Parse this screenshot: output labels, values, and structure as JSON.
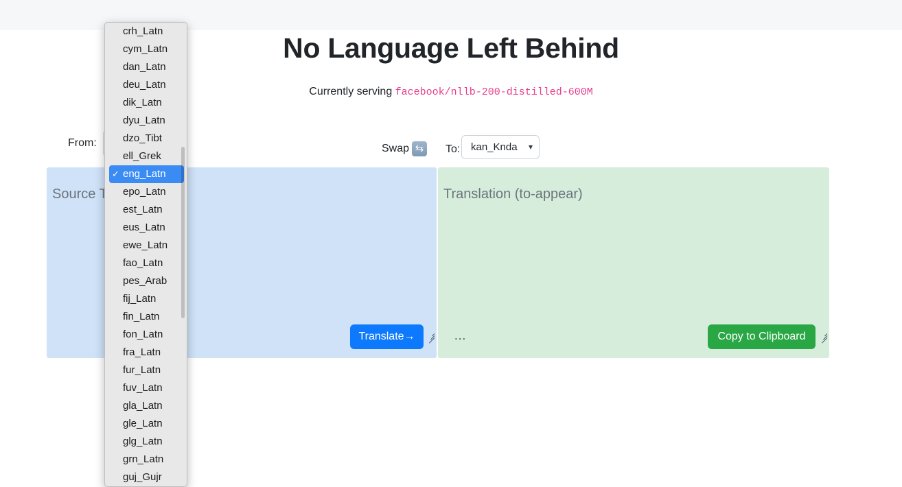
{
  "header": {
    "title": "No Language Left Behind",
    "serving_prefix": "Currently serving",
    "model_name": "facebook/nllb-200-distilled-600M"
  },
  "controls": {
    "from_label": "From:",
    "swap_label": "Swap",
    "swap_icon": "swap-repeat-icon",
    "to_label": "To:",
    "to_value": "kan_Knda",
    "caret": "⌄"
  },
  "source_panel": {
    "placeholder": "Source Text",
    "translate_button": "Translate→",
    "accent_color": "#0d7afd",
    "background": "#cfe2f8"
  },
  "target_panel": {
    "placeholder": "Translation (to-appear)",
    "copy_button": "Copy to Clipboard",
    "status_dots": "...",
    "accent_color": "#29a745",
    "background": "#d7eddb"
  },
  "language_dropdown": {
    "selected": "eng_Latn",
    "options": [
      "crh_Latn",
      "cym_Latn",
      "dan_Latn",
      "deu_Latn",
      "dik_Latn",
      "dyu_Latn",
      "dzo_Tibt",
      "ell_Grek",
      "eng_Latn",
      "epo_Latn",
      "est_Latn",
      "eus_Latn",
      "ewe_Latn",
      "fao_Latn",
      "pes_Arab",
      "fij_Latn",
      "fin_Latn",
      "fon_Latn",
      "fra_Latn",
      "fur_Latn",
      "fuv_Latn",
      "gla_Latn",
      "gle_Latn",
      "glg_Latn",
      "grn_Latn",
      "guj_Gujr"
    ]
  }
}
